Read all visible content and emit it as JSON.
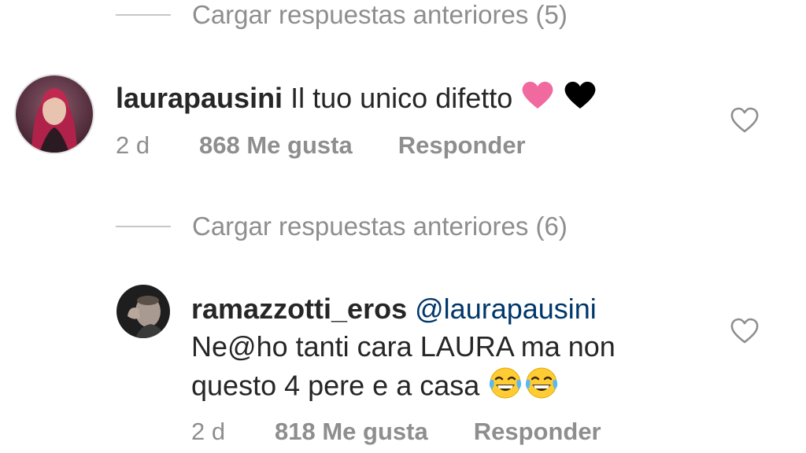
{
  "thread1": {
    "load_more_label": "Cargar respuestas anteriores (5)",
    "comment": {
      "username": "laurapausini",
      "text": "Il tuo unico difetto",
      "emojis": [
        "pink-heart-icon",
        "black-heart-icon"
      ],
      "time": "2 d",
      "likes": "868 Me gusta",
      "reply_label": "Responder"
    }
  },
  "thread2": {
    "load_more_label": "Cargar respuestas anteriores (6)",
    "comment": {
      "username": "ramazzotti_eros",
      "mention": "@laurapausini",
      "line2": "Ne@ho tanti cara LAURA ma non",
      "line3": "questo 4 pere e a casa",
      "emojis": [
        "tears-of-joy-icon",
        "tears-of-joy-icon"
      ],
      "time": "2 d",
      "likes": "818 Me gusta",
      "reply_label": "Responder"
    }
  },
  "colors": {
    "text": "#262626",
    "secondary": "#8e8e8e",
    "mention": "#00376b",
    "pink_heart": "#f06aa0",
    "black_heart": "#000000",
    "emoji_yellow": "#ffcc33"
  }
}
